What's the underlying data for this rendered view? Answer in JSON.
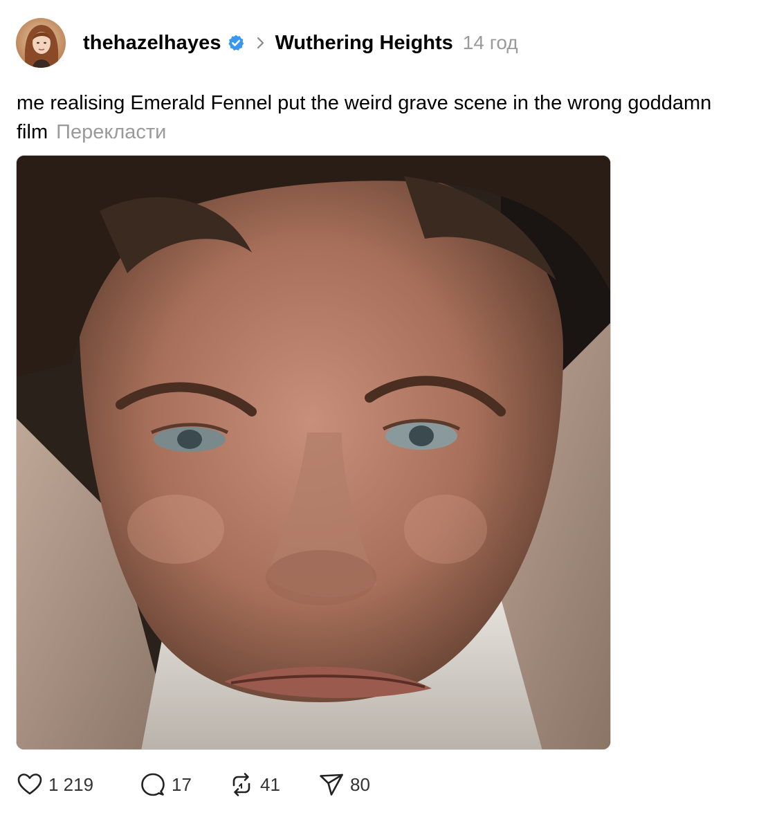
{
  "post": {
    "username": "thehazelhayes",
    "topic": "Wuthering Heights",
    "time": "14 год",
    "caption": "me realising Emerald Fennel put the weird grave scene in the wrong goddamn film",
    "translate_label": "Перекласти"
  },
  "actions": {
    "likes": "1 219",
    "replies": "17",
    "reposts": "41",
    "shares": "80"
  },
  "icons": {
    "verified": "verified-badge-icon",
    "chevron": "chevron-right-icon",
    "like": "heart-icon",
    "reply": "speech-bubble-icon",
    "repost": "repost-arrows-icon",
    "share": "paper-plane-icon"
  },
  "colors": {
    "verified_blue": "#3897f0",
    "muted_text": "#9a9a9a"
  }
}
